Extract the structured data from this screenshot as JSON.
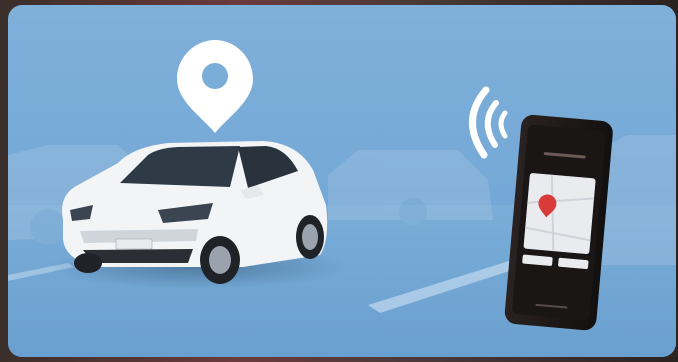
{
  "scene": {
    "background_color": "#74a8d6",
    "accent_color": "#ffffff",
    "location_pin": {
      "icon": "map-pin-icon",
      "color": "#ffffff"
    },
    "wireless_signal": {
      "icon": "wifi-signal-icon",
      "color": "#ffffff"
    },
    "car": {
      "color": "#f2f4f6",
      "license_plate": ""
    },
    "phone": {
      "screen_title": "",
      "marker_color": "#d93a3a",
      "buttons": [
        "",
        ""
      ]
    }
  }
}
